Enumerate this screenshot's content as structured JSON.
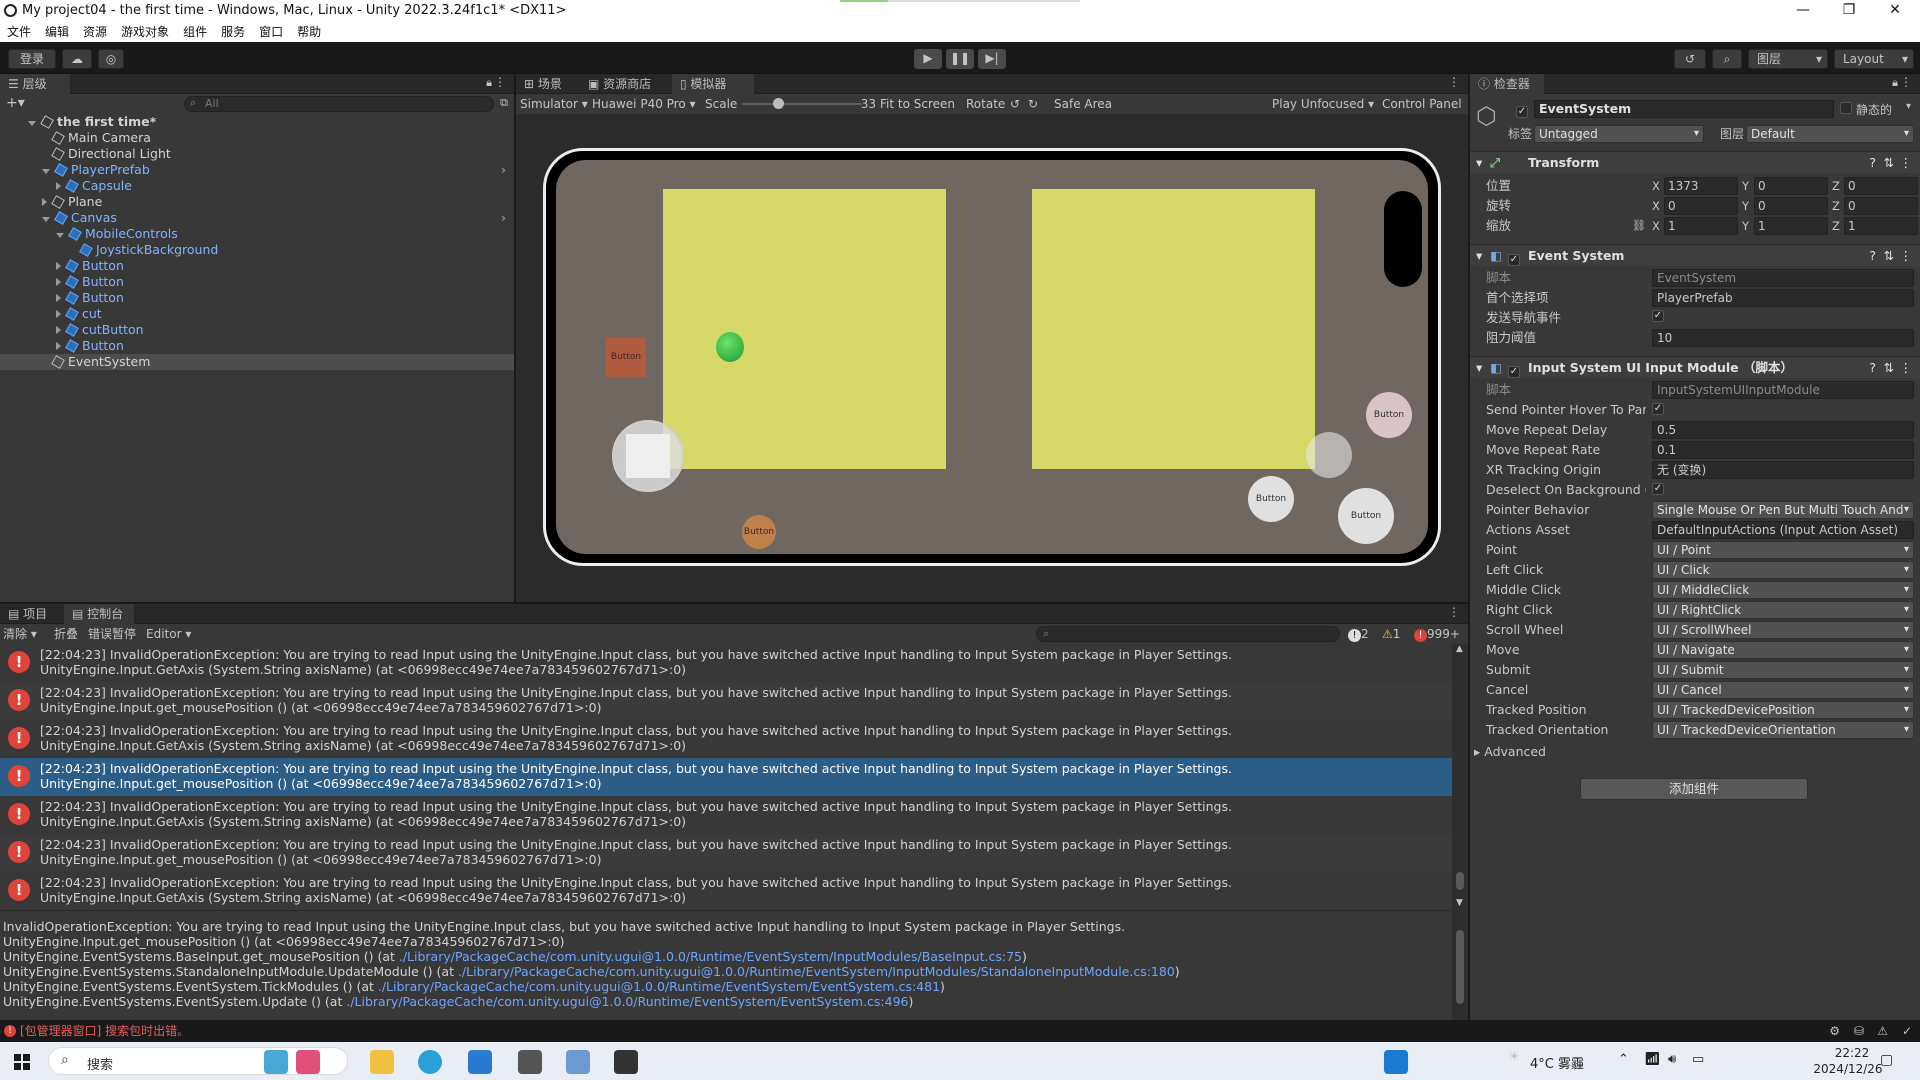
{
  "window": {
    "title": "My project04 - the first time - Windows, Mac, Linux - Unity 2022.3.24f1c1* <DX11>",
    "minimize": "—",
    "maximize": "❐",
    "close": "✕"
  },
  "menu": [
    "文件",
    "编辑",
    "资源",
    "游戏对象",
    "组件",
    "服务",
    "窗口",
    "帮助"
  ],
  "toolbar": {
    "login": "登录",
    "layers": "图层",
    "layout": "Layout"
  },
  "hierarchy": {
    "tab": "层级",
    "search_placeholder": "All",
    "items": [
      {
        "label": "the first time*",
        "depth": 0,
        "kind": "scene"
      },
      {
        "label": "Main Camera",
        "depth": 1
      },
      {
        "label": "Directional Light",
        "depth": 1
      },
      {
        "label": "PlayerPrefab",
        "depth": 1,
        "blue": true
      },
      {
        "label": "Capsule",
        "depth": 2,
        "blue": true
      },
      {
        "label": "Plane",
        "depth": 1
      },
      {
        "label": "Canvas",
        "depth": 1,
        "blue": true
      },
      {
        "label": "MobileControls",
        "depth": 2,
        "blue": true
      },
      {
        "label": "JoystickBackground",
        "depth": 3,
        "blue": true
      },
      {
        "label": "Button",
        "depth": 2,
        "blue": true
      },
      {
        "label": "Button",
        "depth": 2,
        "blue": true
      },
      {
        "label": "Button",
        "depth": 2,
        "blue": true
      },
      {
        "label": "cut",
        "depth": 2,
        "blue": true
      },
      {
        "label": "cutButton",
        "depth": 2,
        "blue": true
      },
      {
        "label": "Button",
        "depth": 2,
        "blue": true
      },
      {
        "label": "EventSystem",
        "depth": 1,
        "selected": true
      }
    ]
  },
  "center": {
    "tabs": [
      "场景",
      "资源商店",
      "模拟器"
    ],
    "simulator": "Simulator",
    "device": "Huawei P40 Pro",
    "scale_label": "Scale",
    "scale_value": "33",
    "scale_fraction": 0.3,
    "fit": "Fit to Screen",
    "rotate": "Rotate",
    "safe_area": "Safe Area",
    "play_mode": "Play Unfocused",
    "control_panel": "Control Panel",
    "game_buttons": {
      "left_square": "Button",
      "bottom_orange": "Button",
      "right_top": "Button",
      "right_mid": "Button",
      "right_bottom": "Button"
    }
  },
  "inspector": {
    "tab": "检查器",
    "object_name": "EventSystem",
    "static_label": "静态的",
    "tag_label": "标签",
    "tag_value": "Untagged",
    "layer_label": "图层",
    "layer_value": "Default",
    "transform": {
      "title": "Transform",
      "position_label": "位置",
      "rotation_label": "旋转",
      "scale_label": "缩放",
      "position": [
        "1373",
        "0",
        "0"
      ],
      "rotation": [
        "0",
        "0",
        "0"
      ],
      "scale": [
        "1",
        "1",
        "1"
      ]
    },
    "event_system": {
      "title": "Event System",
      "script_label": "脚本",
      "script_value": "EventSystem",
      "first_selected_label": "首个选择项",
      "first_selected_value": "PlayerPrefab",
      "send_nav_label": "发送导航事件",
      "drag_threshold_label": "阻力阈值",
      "drag_threshold_value": "10"
    },
    "input_module": {
      "title": "Input System UI Input Module （脚本）",
      "rows": [
        {
          "label": "脚本",
          "value": "InputSystemUIInputModule",
          "type": "field"
        },
        {
          "label": "Send Pointer Hover To Pare",
          "value": "✓",
          "type": "check"
        },
        {
          "label": "Move Repeat Delay",
          "value": "0.5",
          "type": "field"
        },
        {
          "label": "Move Repeat Rate",
          "value": "0.1",
          "type": "field"
        },
        {
          "label": "XR Tracking Origin",
          "value": "无 (变换)",
          "type": "field"
        },
        {
          "label": "Deselect On Background Cli",
          "value": "✓",
          "type": "check"
        },
        {
          "label": "Pointer Behavior",
          "value": "Single Mouse Or Pen But Multi Touch And",
          "type": "dropdown"
        },
        {
          "label": "Actions Asset",
          "value": "DefaultInputActions (Input Action Asset)",
          "type": "field"
        },
        {
          "label": "Point",
          "value": "UI / Point",
          "type": "dropdown"
        },
        {
          "label": "Left Click",
          "value": "UI / Click",
          "type": "dropdown"
        },
        {
          "label": "Middle Click",
          "value": "UI / MiddleClick",
          "type": "dropdown"
        },
        {
          "label": "Right Click",
          "value": "UI / RightClick",
          "type": "dropdown"
        },
        {
          "label": "Scroll Wheel",
          "value": "UI / ScrollWheel",
          "type": "dropdown"
        },
        {
          "label": "Move",
          "value": "UI / Navigate",
          "type": "dropdown"
        },
        {
          "label": "Submit",
          "value": "UI / Submit",
          "type": "dropdown"
        },
        {
          "label": "Cancel",
          "value": "UI / Cancel",
          "type": "dropdown"
        },
        {
          "label": "Tracked Position",
          "value": "UI / TrackedDevicePosition",
          "type": "dropdown"
        },
        {
          "label": "Tracked Orientation",
          "value": "UI / TrackedDeviceOrientation",
          "type": "dropdown"
        }
      ],
      "advanced": "Advanced"
    },
    "add_component": "添加组件"
  },
  "console": {
    "tabs": [
      "项目",
      "控制台"
    ],
    "clear": "清除",
    "collapse": "折叠",
    "error_pause": "错误暂停",
    "editor": "Editor",
    "count_info": "2",
    "count_warn": "1",
    "count_error": "999+",
    "messages": [
      {
        "line1": "[22:04:23] InvalidOperationException: You are trying to read Input using the UnityEngine.Input class, but you have switched active Input handling to Input System package in Player Settings.",
        "line2": "UnityEngine.Input.GetAxis (System.String axisName) (at <06998ecc49e74ee7a783459602767d71>:0)"
      },
      {
        "line1": "[22:04:23] InvalidOperationException: You are trying to read Input using the UnityEngine.Input class, but you have switched active Input handling to Input System package in Player Settings.",
        "line2": "UnityEngine.Input.get_mousePosition () (at <06998ecc49e74ee7a783459602767d71>:0)"
      },
      {
        "line1": "[22:04:23] InvalidOperationException: You are trying to read Input using the UnityEngine.Input class, but you have switched active Input handling to Input System package in Player Settings.",
        "line2": "UnityEngine.Input.GetAxis (System.String axisName) (at <06998ecc49e74ee7a783459602767d71>:0)"
      },
      {
        "line1": "[22:04:23] InvalidOperationException: You are trying to read Input using the UnityEngine.Input class, but you have switched active Input handling to Input System package in Player Settings.",
        "line2": "UnityEngine.Input.get_mousePosition () (at <06998ecc49e74ee7a783459602767d71>:0)",
        "selected": true
      },
      {
        "line1": "[22:04:23] InvalidOperationException: You are trying to read Input using the UnityEngine.Input class, but you have switched active Input handling to Input System package in Player Settings.",
        "line2": "UnityEngine.Input.GetAxis (System.String axisName) (at <06998ecc49e74ee7a783459602767d71>:0)"
      },
      {
        "line1": "[22:04:23] InvalidOperationException: You are trying to read Input using the UnityEngine.Input class, but you have switched active Input handling to Input System package in Player Settings.",
        "line2": "UnityEngine.Input.get_mousePosition () (at <06998ecc49e74ee7a783459602767d71>:0)"
      },
      {
        "line1": "[22:04:23] InvalidOperationException: You are trying to read Input using the UnityEngine.Input class, but you have switched active Input handling to Input System package in Player Settings.",
        "line2": "UnityEngine.Input.GetAxis (System.String axisName) (at <06998ecc49e74ee7a783459602767d71>:0)"
      }
    ],
    "detail": [
      {
        "text": "InvalidOperationException: You are trying to read Input using the UnityEngine.Input class, but you have switched active Input handling to Input System package in Player Settings.",
        "link": ""
      },
      {
        "text": "UnityEngine.Input.get_mousePosition () (at <06998ecc49e74ee7a783459602767d71>:0)",
        "link": ""
      },
      {
        "text": "UnityEngine.EventSystems.BaseInput.get_mousePosition () (at ",
        "link": "./Library/PackageCache/com.unity.ugui@1.0.0/Runtime/EventSystem/InputModules/BaseInput.cs:75",
        "tail": ")"
      },
      {
        "text": "UnityEngine.EventSystems.StandaloneInputModule.UpdateModule () (at ",
        "link": "./Library/PackageCache/com.unity.ugui@1.0.0/Runtime/EventSystem/InputModules/StandaloneInputModule.cs:180",
        "tail": ")"
      },
      {
        "text": "UnityEngine.EventSystems.EventSystem.TickModules () (at ",
        "link": "./Library/PackageCache/com.unity.ugui@1.0.0/Runtime/EventSystem/EventSystem.cs:481",
        "tail": ")"
      },
      {
        "text": "UnityEngine.EventSystems.EventSystem.Update () (at ",
        "link": "./Library/PackageCache/com.unity.ugui@1.0.0/Runtime/EventSystem/EventSystem.cs:496",
        "tail": ")"
      }
    ]
  },
  "statusbar": {
    "message": "[包管理器窗口] 搜索包时出错。"
  },
  "taskbar": {
    "search": "搜索",
    "weather": "4°C 雾霾",
    "time": "22:22",
    "date": "2024/12/26"
  }
}
